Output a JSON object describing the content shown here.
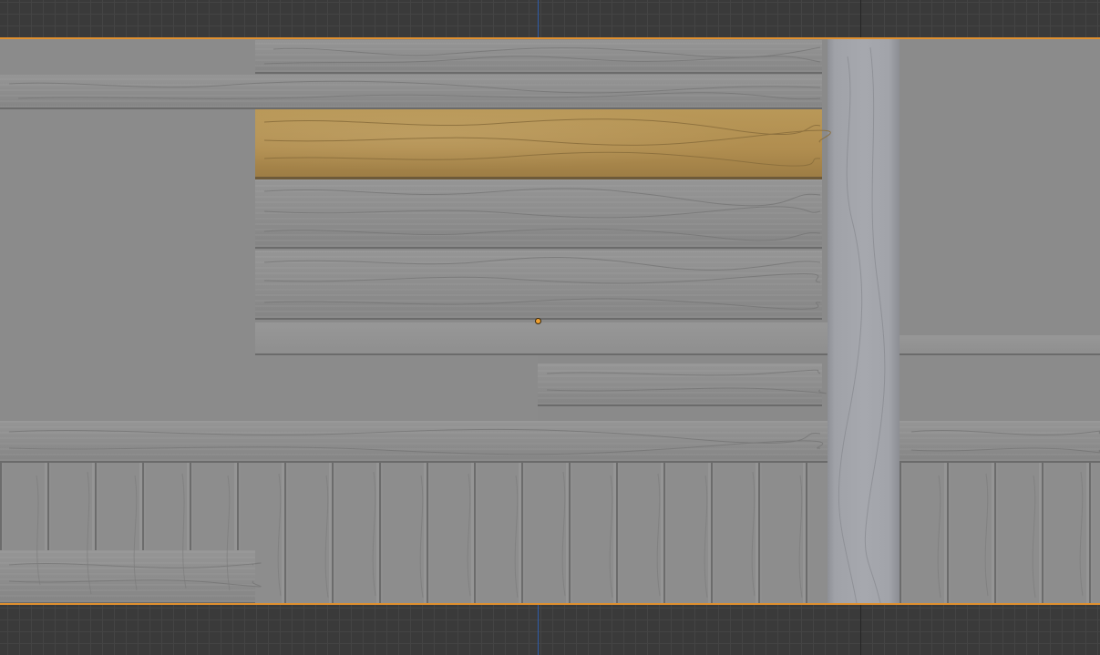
{
  "viewport": {
    "kind": "uv-texture-editor",
    "background_color": "#3a3a3a",
    "grid_color": "#444444",
    "axis_color": "#2f5ca8",
    "image_bounds_color": "#e0902f",
    "plank_color": "#8c8c8c",
    "selected_plank_color": "#b08d4f",
    "post_color": "#a4a6ac",
    "cursor_icon": "2d-cursor-icon"
  }
}
